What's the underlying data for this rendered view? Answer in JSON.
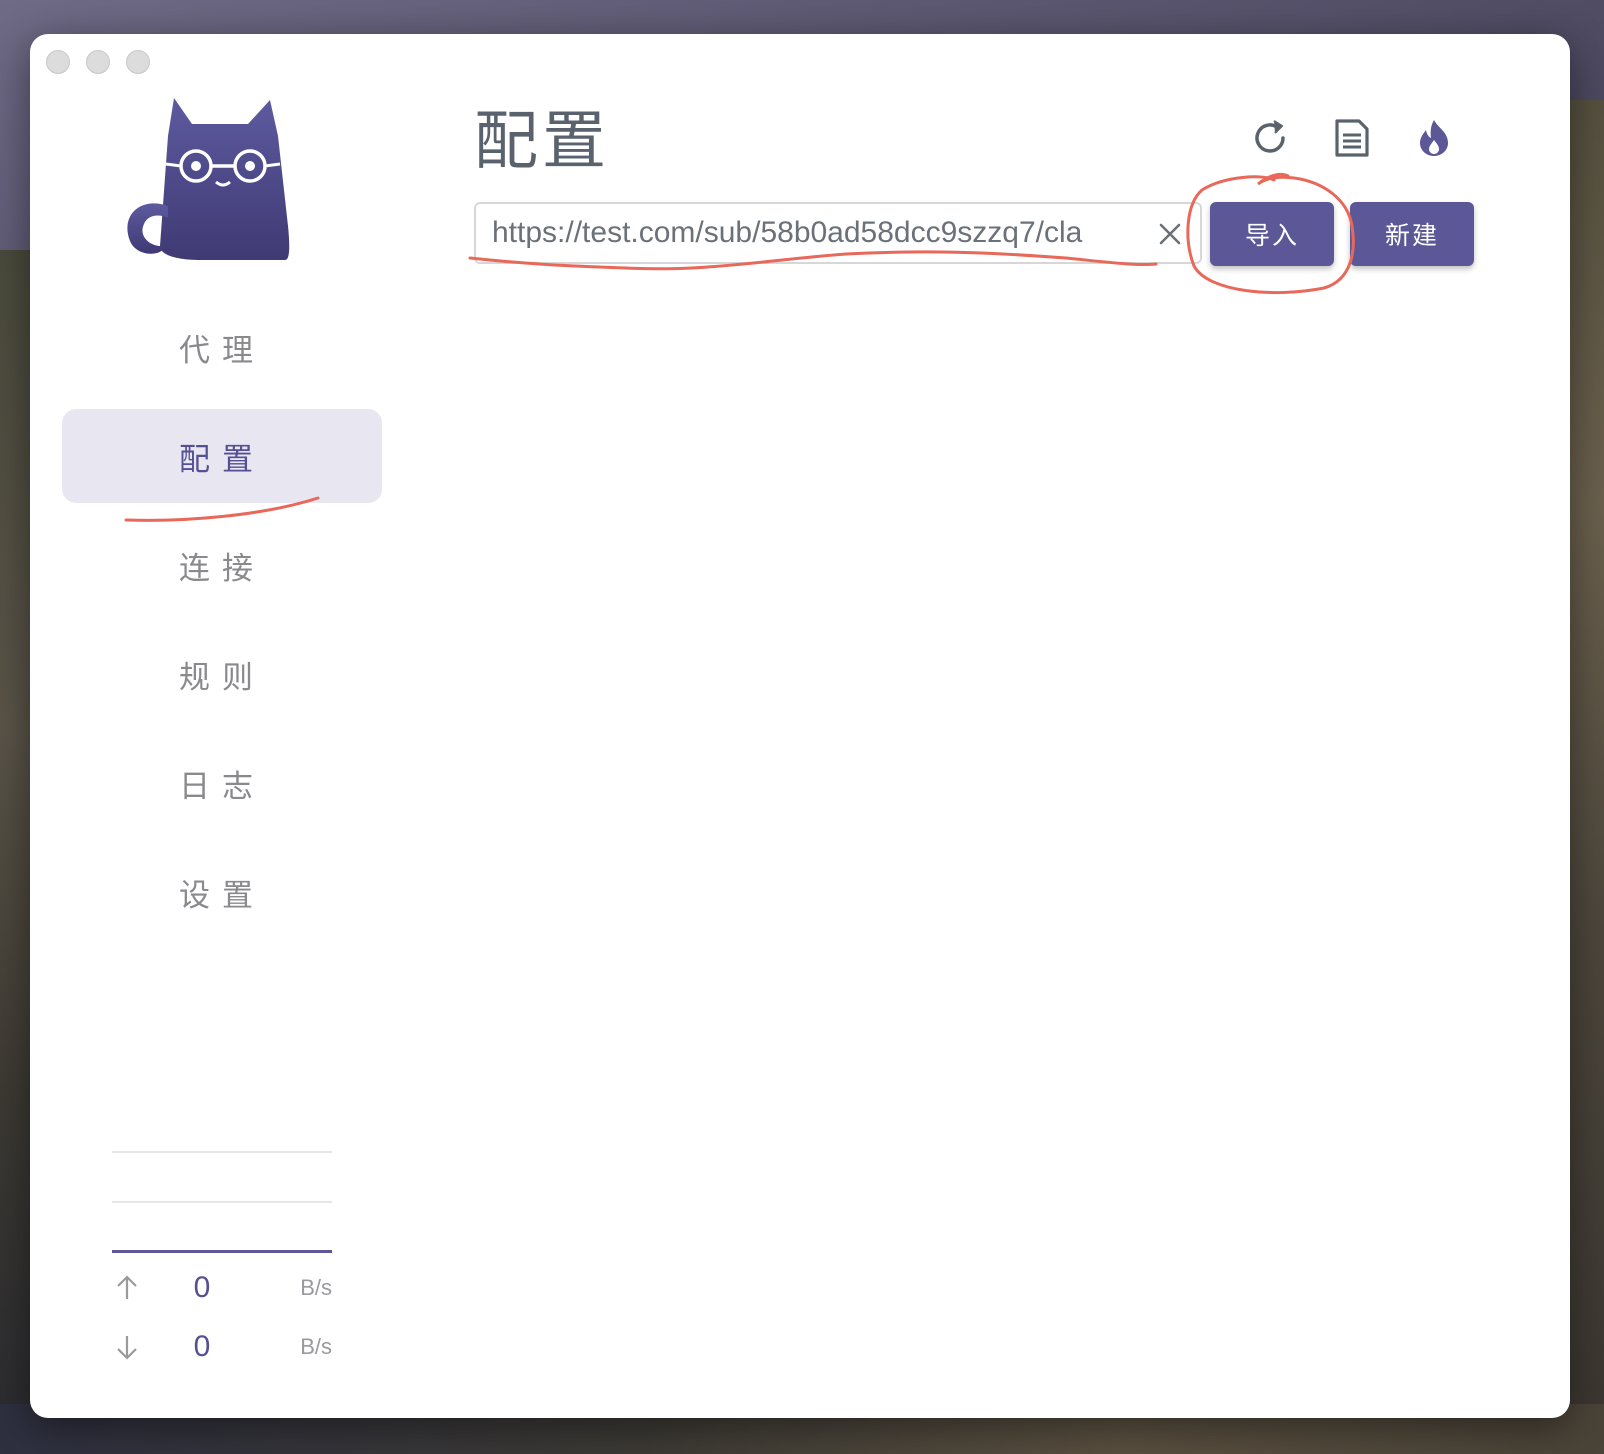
{
  "window": {
    "traffic_lights": [
      "close",
      "minimize",
      "maximize"
    ]
  },
  "sidebar": {
    "logo_icon": "cat-with-glasses-icon",
    "items": [
      {
        "label": "代理",
        "active": false
      },
      {
        "label": "配置",
        "active": true
      },
      {
        "label": "连接",
        "active": false
      },
      {
        "label": "规则",
        "active": false
      },
      {
        "label": "日志",
        "active": false
      },
      {
        "label": "设置",
        "active": false
      }
    ],
    "traffic": {
      "upload": {
        "icon": "arrow-up-icon",
        "value": "0",
        "unit": "B/s"
      },
      "download": {
        "icon": "arrow-down-icon",
        "value": "0",
        "unit": "B/s"
      }
    }
  },
  "main": {
    "title": "配置",
    "toolbar_icons": [
      "refresh-icon",
      "document-icon",
      "flame-icon"
    ],
    "url_input": {
      "value": "https://test.com/sub/58b0ad58dcc9szzq7/cla",
      "clear_icon": "close-icon"
    },
    "import_label": "导入",
    "new_label": "新建"
  },
  "colors": {
    "accent": "#5c5897",
    "active_bg": "#e8e7f1",
    "annotation": "#e8685a"
  }
}
